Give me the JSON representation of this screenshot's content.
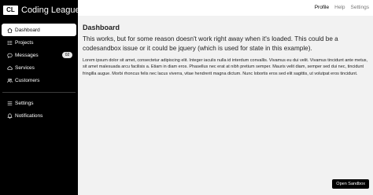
{
  "brand": {
    "logo_text": "CL",
    "name": "Coding League"
  },
  "sidebar": {
    "main_items": [
      {
        "label": "Dashboard",
        "icon": "home-icon",
        "active": true
      },
      {
        "label": "Projects",
        "icon": "list-icon"
      },
      {
        "label": "Messages",
        "icon": "chat-icon",
        "badge": "02"
      },
      {
        "label": "Services",
        "icon": "cloud-icon"
      },
      {
        "label": "Customers",
        "icon": "users-icon"
      }
    ],
    "secondary_items": [
      {
        "label": "Settings",
        "icon": "menu-icon"
      },
      {
        "label": "Notifications",
        "icon": "bell-icon"
      }
    ]
  },
  "topbar": {
    "links": [
      {
        "label": "Profile",
        "active": true
      },
      {
        "label": "Help"
      },
      {
        "label": "Settings"
      }
    ]
  },
  "main": {
    "title": "Dashboard",
    "lead": "This works, but for some reason doesn't work right away when it's loaded. This could be a codesandbox issue or it could be jquery (which is used for state in this example).",
    "body": "Lorem ipsum dolor sit amet, consectetur adipiscing elit. Integer iaculis nulla id interdum convallis. Vivamus eu dui velit. Vivamus tincidunt ante metus, sit amet malesuada arcu facilisis a. Etiam in diam eros. Phasellus nec erat at nibh pretium semper. Mauris velit diam, semper sed dui nec, tincidunt fringilla augue. Morbi rhoncus felis nec lacus viverra, vitae hendrerit magna dictum. Nunc lobortis eros sed elit sagittis, ut volutpat eros tincidunt.",
    "open_button": "Open Sandbox"
  }
}
